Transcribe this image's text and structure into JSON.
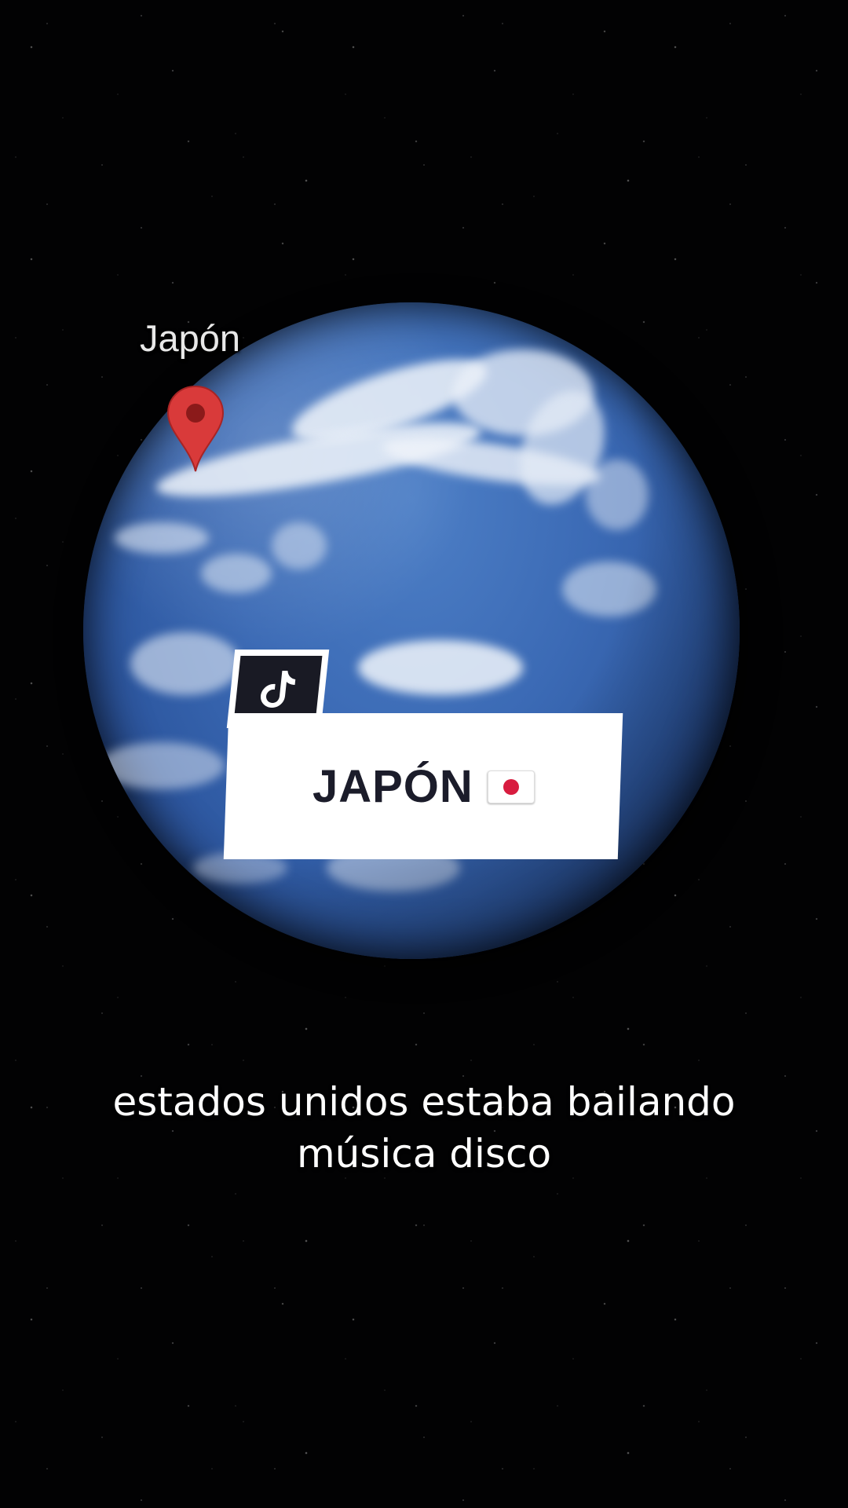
{
  "map": {
    "pin_label": "Japón"
  },
  "overlay": {
    "title": "JAPÓN",
    "flag_icon": "japan-flag-icon",
    "app_icon": "tiktok-icon"
  },
  "caption": {
    "line1": "estados unidos estaba bailando",
    "line2": "música disco"
  },
  "colors": {
    "pin": "#d93a3a",
    "title_text": "#1b1c2a",
    "flag_red": "#d81c3f",
    "badge_bg": "#191a24"
  }
}
